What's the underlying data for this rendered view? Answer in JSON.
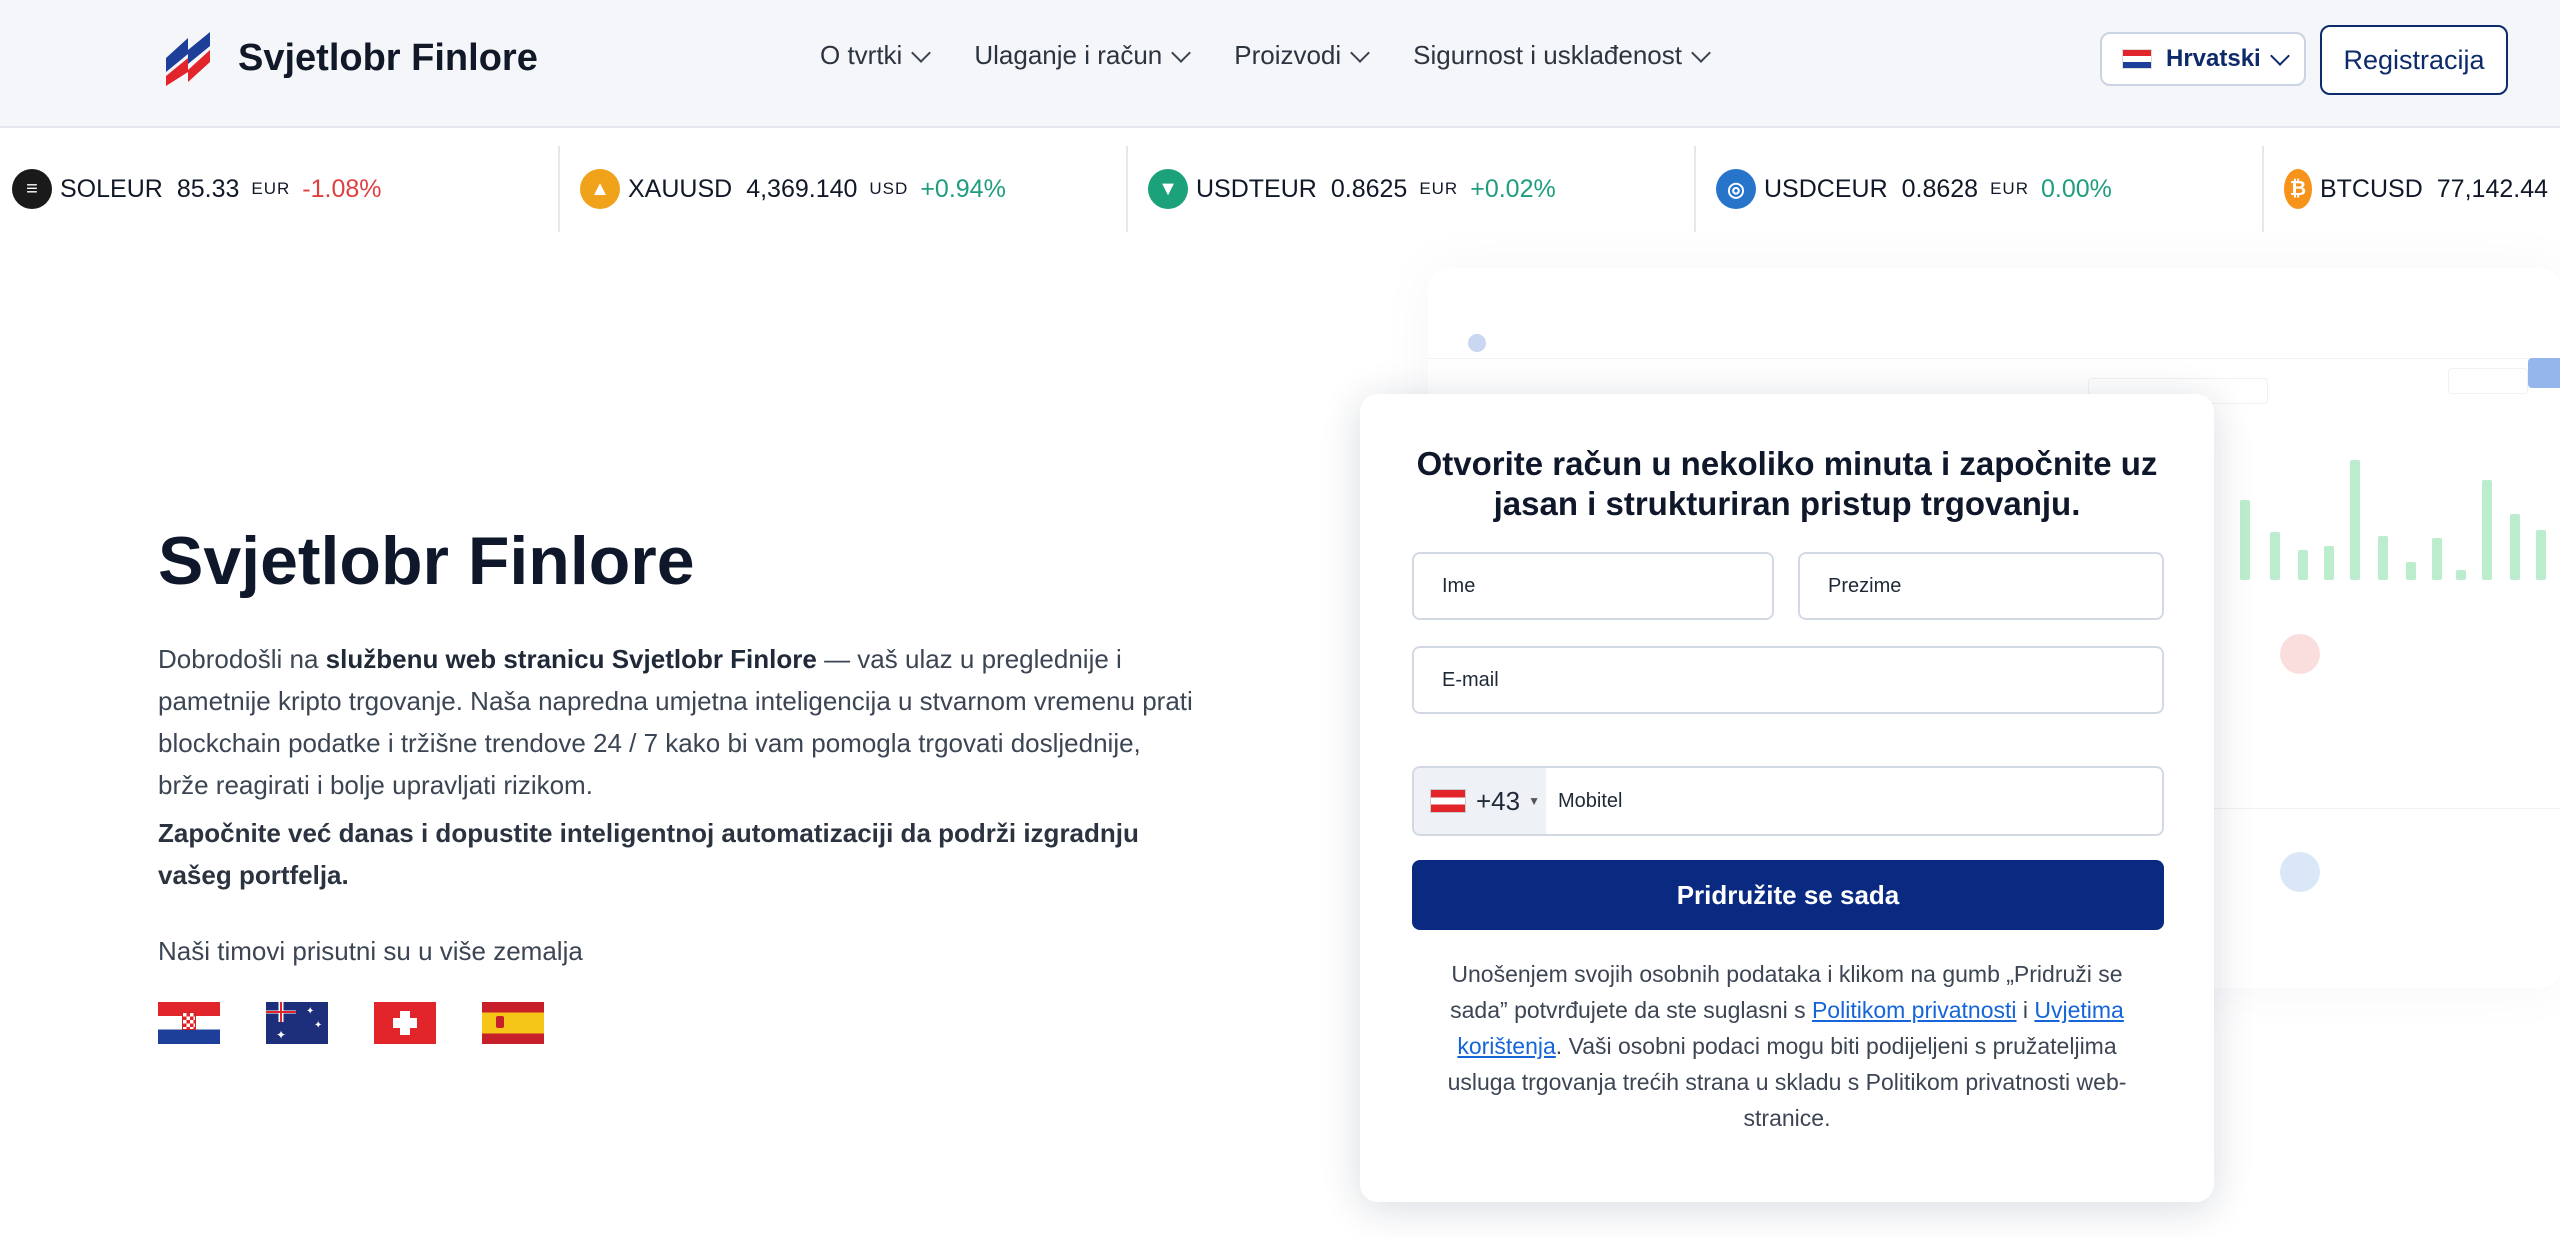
{
  "brand": {
    "name": "Svjetlobr Finlore"
  },
  "nav": {
    "items": [
      {
        "label": "O tvrtki"
      },
      {
        "label": "Ulaganje i račun"
      },
      {
        "label": "Proizvodi"
      },
      {
        "label": "Sigurnost i usklađenost"
      }
    ],
    "language": "Hrvatski",
    "register": "Registracija"
  },
  "ticker": [
    {
      "symbol": "SOLEUR",
      "price": "85.33",
      "currency": "EUR",
      "change": "-1.08%",
      "icon": "solana-icon",
      "color": "#1a1a1a"
    },
    {
      "symbol": "XAUUSD",
      "price": "4,369.140",
      "currency": "USD",
      "change": "+0.94%",
      "icon": "gold-icon",
      "color": "#f0a21a"
    },
    {
      "symbol": "USDTEUR",
      "price": "0.8625",
      "currency": "EUR",
      "change": "+0.02%",
      "icon": "tether-icon",
      "color": "#1ba27a"
    },
    {
      "symbol": "USDCEUR",
      "price": "0.8628",
      "currency": "EUR",
      "change": "0.00%",
      "icon": "usdc-icon",
      "color": "#2775ca"
    },
    {
      "symbol": "BTCUSD",
      "price": "77,142.44",
      "currency": "",
      "change": "",
      "icon": "bitcoin-icon",
      "color": "#f7931a"
    }
  ],
  "hero": {
    "title": "Svjetlobr Finlore",
    "intro_pre": "Dobrodošli na ",
    "intro_bold": "službenu web stranicu Svjetlobr Finlore",
    "intro_post": " — vaš ulaz u preglednije i pametnije kripto trgovanje. Naša napredna umjetna inteligencija u stvarnom vremenu prati blockchain podatke i tržišne trendove 24 / 7 kako bi vam pomogla trgovati dosljednije, brže reagirati i bolje upravljati rizikom.",
    "cta": "Započnite već danas i dopustite inteligentnoj automatizaciji da podrži izgradnju vašeg portfelja.",
    "teams": "Naši timovi prisutni su u više zemalja"
  },
  "form": {
    "title": "Otvorite račun u nekoliko minuta i započnite uz jasan i strukturiran pristup trgovanju.",
    "first_name": "Ime",
    "last_name": "Prezime",
    "email": "E-mail",
    "phone_code": "+43",
    "phone": "Mobitel",
    "submit": "Pridružite se sada",
    "consent_1": "Unošenjem svojih osobnih podataka i klikom na gumb „Pridruži se sada” potvrđujete da ste suglasni s ",
    "privacy_link": "Politikom privatnosti",
    "consent_and": " i ",
    "terms_link": "Uvjetima korištenja",
    "consent_2": ". Vaši osobni podaci mogu biti podijeljeni s pružateljima usluga trgovanja trećih strana u skladu s Politikom privatnosti web-stranice."
  },
  "colors": {
    "primary": "#0a2a82",
    "negative": "#e03f3f",
    "positive": "#1e9e7f",
    "link": "#1565d8"
  }
}
